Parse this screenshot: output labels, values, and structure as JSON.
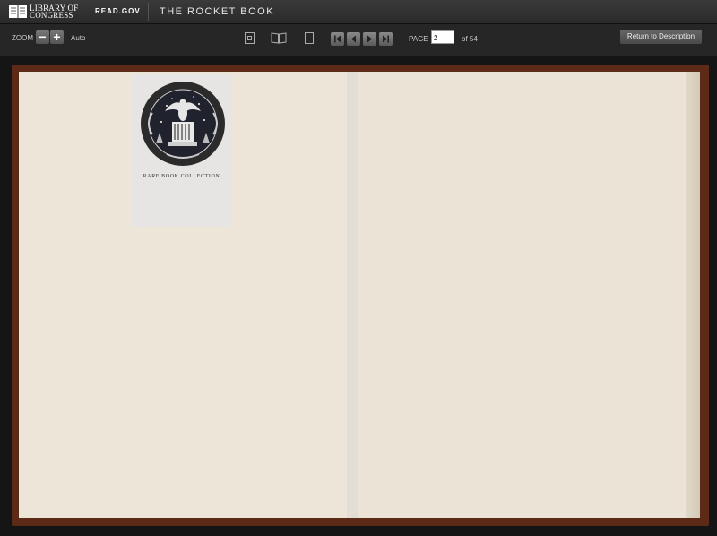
{
  "header": {
    "logo_line1": "LIBRARY OF",
    "logo_line2": "CONGRESS",
    "site": "READ.GOV",
    "title": "THE ROCKET BOOK"
  },
  "toolbar": {
    "zoom_label": "ZOOM",
    "zoom_out": "−",
    "zoom_in": "+",
    "zoom_mode": "Auto",
    "page_label": "PAGE",
    "page_value": "2",
    "page_total": "of 54",
    "return_label": "Return to Description"
  },
  "bookplate": {
    "caption": "RARE BOOK COLLECTION"
  },
  "colors": {
    "cover": "#5e2a18",
    "page": "#ece5d8"
  }
}
